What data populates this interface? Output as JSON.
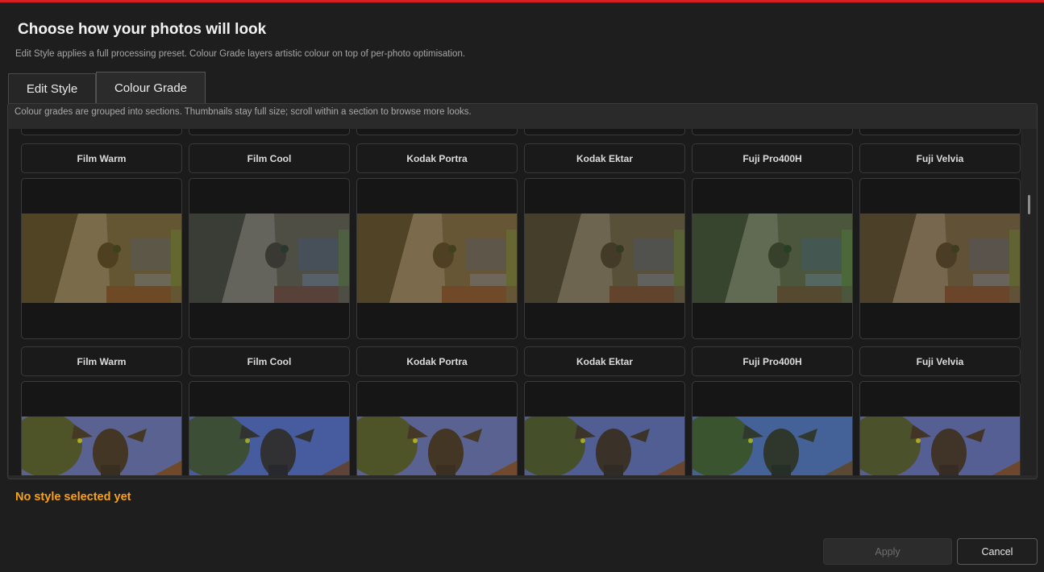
{
  "header": {
    "title": "Choose how your photos will look",
    "subtitle": "Edit Style applies a full processing preset. Colour Grade layers artistic colour on top of per-photo optimisation."
  },
  "tabs": [
    {
      "label": "Edit Style",
      "active": false
    },
    {
      "label": "Colour Grade",
      "active": true
    }
  ],
  "panel": {
    "hint": "Colour grades are grouped into sections. Thumbnails stay full size; scroll within a section to browse more looks."
  },
  "grades": [
    "Film Warm",
    "Film Cool",
    "Kodak Portra",
    "Kodak Ektar",
    "Fuji Pro400H",
    "Fuji Velvia"
  ],
  "grade_tints": [
    "#5a4a20",
    "#1f3550",
    "#5c4a25",
    "#3a3a30",
    "#184a3a",
    "#4e3f2a"
  ],
  "status": "No style selected yet",
  "actions": {
    "apply": "Apply",
    "cancel": "Cancel"
  },
  "colors": {
    "accent_top": "#d81e1e",
    "status": "#f7a21b"
  }
}
